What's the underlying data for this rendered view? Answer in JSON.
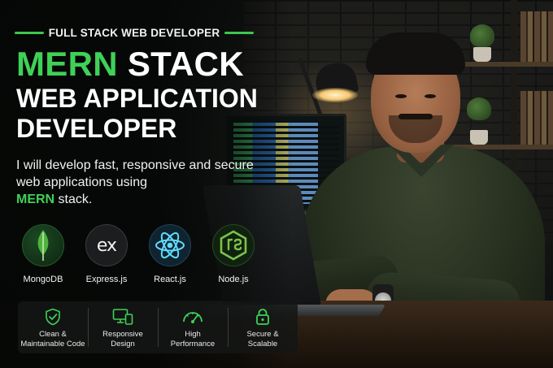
{
  "tagline": "FULL STACK WEB DEVELOPER",
  "headline": {
    "accent": "MERN",
    "rest": " STACK",
    "line2": "WEB APPLICATION",
    "line3": "DEVELOPER"
  },
  "description": {
    "text": "I will develop fast, responsive and secure web applications using",
    "accent": "MERN",
    "suffix": " stack."
  },
  "technologies": [
    {
      "label": "MongoDB",
      "icon": "mongodb-leaf-icon"
    },
    {
      "label": "Express.js",
      "icon": "express-ex-icon",
      "glyph": "ex"
    },
    {
      "label": "React.js",
      "icon": "react-atom-icon"
    },
    {
      "label": "Node.js",
      "icon": "nodejs-hexagon-icon"
    }
  ],
  "features": [
    {
      "label": "Clean &\nMaintainable Code",
      "icon": "shield-check-icon"
    },
    {
      "label": "Responsive\nDesign",
      "icon": "devices-icon"
    },
    {
      "label": "High\nPerformance",
      "icon": "speedometer-icon"
    },
    {
      "label": "Secure &\nScalable",
      "icon": "lock-icon"
    }
  ],
  "colors": {
    "accent": "#3fd157",
    "background": "#0b0d0c",
    "text": "#ffffff"
  }
}
